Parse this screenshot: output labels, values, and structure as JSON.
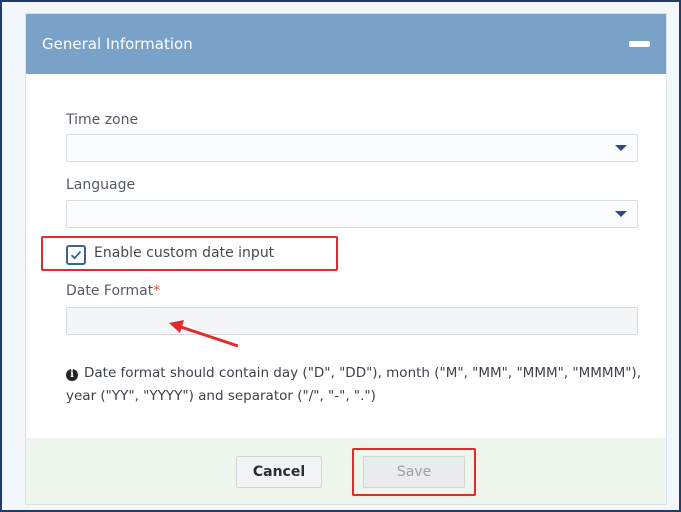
{
  "panel": {
    "title": "General Information"
  },
  "form": {
    "timezone": {
      "label": "Time zone",
      "value": ""
    },
    "language": {
      "label": "Language",
      "value": ""
    },
    "custom_date": {
      "label": "Enable custom date input",
      "checked": true
    },
    "date_format": {
      "label": "Date Format",
      "required_marker": "*",
      "value": ""
    },
    "info_text": "Date format should contain day (\"D\", \"DD\"), month (\"M\", \"MM\", \"MMM\", \"MMMM\"), year (\"YY\", \"YYYY\") and separator (\"/\", \"-\", \".\")"
  },
  "footer": {
    "cancel_label": "Cancel",
    "save_label": "Save"
  },
  "icons": {
    "collapse": "minus-icon",
    "dropdown": "caret-down-icon",
    "checkbox": "check-icon",
    "info": "info-circle-icon",
    "annotation": "red-arrow-icon"
  },
  "colors": {
    "header_bg": "#7aa1c7",
    "highlight": "#e12a2a",
    "footer_bg": "#eef5ec",
    "required": "#d9534f"
  }
}
